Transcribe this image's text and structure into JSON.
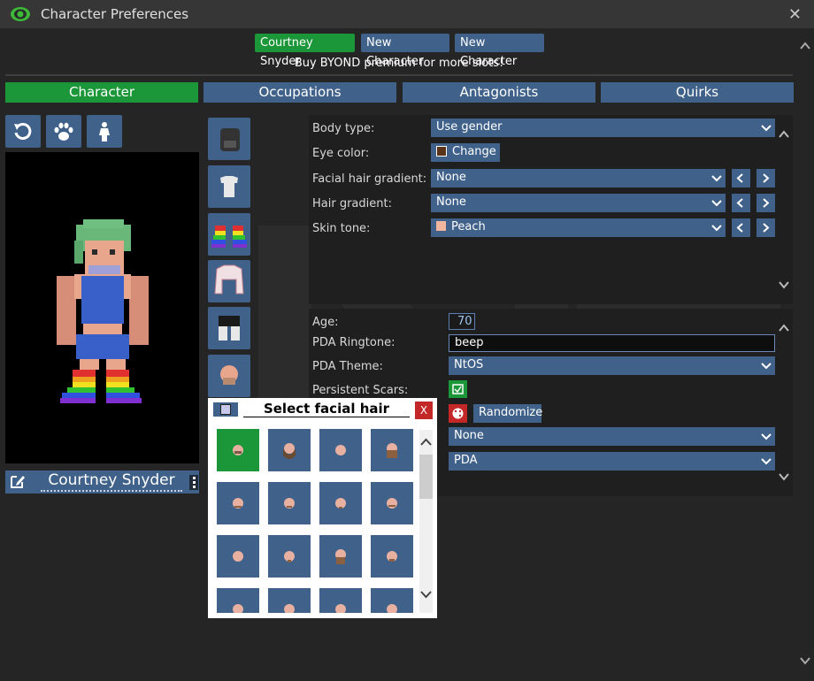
{
  "window": {
    "title": "Character Preferences"
  },
  "slots": [
    "Courtney Snyder",
    "New Character",
    "New Character"
  ],
  "premium_note": "Buy BYOND premium for more slots!",
  "tabs": [
    "Character",
    "Occupations",
    "Antagonists",
    "Quirks"
  ],
  "active_tab": "Character",
  "character": {
    "name": "Courtney Snyder"
  },
  "appearance": {
    "body_type": {
      "label": "Body type:",
      "value": "Use gender"
    },
    "eye_color": {
      "label": "Eye color:",
      "button": "Change",
      "swatch": "#5a3418"
    },
    "facial_hair_gradient": {
      "label": "Facial hair gradient:",
      "value": "None"
    },
    "hair_gradient": {
      "label": "Hair gradient:",
      "value": "None"
    },
    "skin_tone": {
      "label": "Skin tone:",
      "value": "Peach",
      "swatch": "#f0b79e"
    }
  },
  "misc": {
    "age": {
      "label": "Age:",
      "value": "70"
    },
    "ringtone": {
      "label": "PDA Ringtone:",
      "value": "beep"
    },
    "pda_theme": {
      "label": "PDA Theme:",
      "value": "NtOS"
    },
    "persistent_scars": {
      "label": "Persistent Scars:",
      "checked": true
    },
    "random_name_button": "Randomize",
    "dropdown_a": "None",
    "dropdown_b": "PDA"
  },
  "popup": {
    "title": "Select facial hair",
    "close": "X"
  },
  "colors": {
    "accent_green": "#1b9638",
    "button_blue": "#40628a",
    "danger_red": "#c42727"
  }
}
